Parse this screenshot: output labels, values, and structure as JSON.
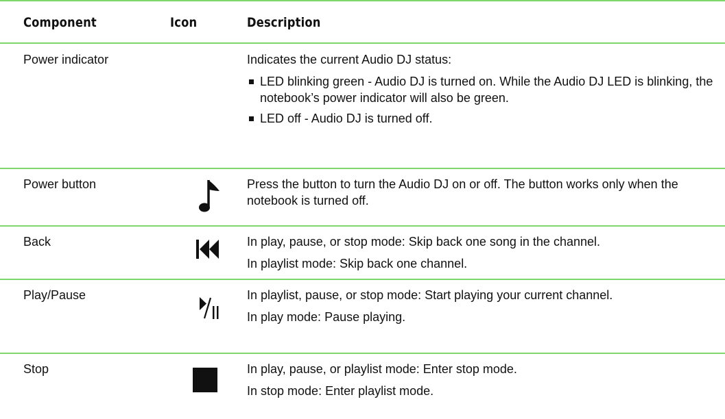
{
  "headers": {
    "component": "Component",
    "icon": "Icon",
    "description": "Description"
  },
  "rows": [
    {
      "component": "Power indicator",
      "icon": "",
      "paragraphs": [
        "Indicates the current Audio DJ status:"
      ],
      "bullets": [
        "LED blinking green - Audio DJ is turned on. While the Audio DJ LED is blinking, the notebook’s power indicator will also be green.",
        "LED off - Audio DJ is turned off."
      ]
    },
    {
      "component": "Power button",
      "icon": "music-note-icon",
      "paragraphs": [
        "Press the button to turn the Audio DJ on or off. The button works only when the notebook is turned off."
      ]
    },
    {
      "component": "Back",
      "icon": "skip-back-icon",
      "paragraphs": [
        "In play, pause, or stop mode: Skip back one song in the channel.",
        "In playlist mode: Skip back one channel."
      ]
    },
    {
      "component": "Play/Pause",
      "icon": "play-pause-icon",
      "paragraphs": [
        "In playlist, pause, or stop mode: Start playing your current channel.",
        "In play mode: Pause playing."
      ]
    },
    {
      "component": "Stop",
      "icon": "stop-icon",
      "paragraphs": [
        "In play, pause, or playlist mode: Enter stop mode.",
        "In stop mode: Enter playlist mode."
      ]
    }
  ],
  "colors": {
    "rule": "#7fd66a",
    "text": "#111111"
  }
}
